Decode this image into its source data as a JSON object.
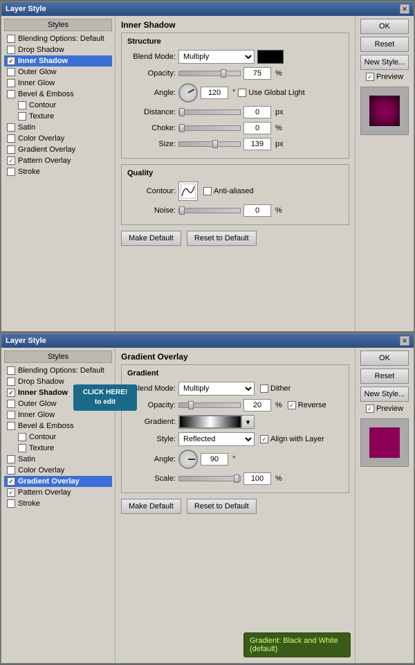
{
  "panel1": {
    "title": "Layer Style",
    "sidebar": {
      "title": "Styles",
      "items": [
        {
          "id": "blending-options",
          "label": "Blending Options: Default",
          "checked": false,
          "active": false,
          "indent": 0,
          "bold": false
        },
        {
          "id": "drop-shadow",
          "label": "Drop Shadow",
          "checked": false,
          "active": false,
          "indent": 0,
          "bold": false
        },
        {
          "id": "inner-shadow",
          "label": "Inner Shadow",
          "checked": true,
          "active": true,
          "indent": 0,
          "bold": true
        },
        {
          "id": "outer-glow",
          "label": "Outer Glow",
          "checked": false,
          "active": false,
          "indent": 0,
          "bold": false
        },
        {
          "id": "inner-glow",
          "label": "Inner Glow",
          "checked": false,
          "active": false,
          "indent": 0,
          "bold": false
        },
        {
          "id": "bevel-emboss",
          "label": "Bevel & Emboss",
          "checked": false,
          "active": false,
          "indent": 0,
          "bold": false
        },
        {
          "id": "contour",
          "label": "Contour",
          "checked": false,
          "active": false,
          "indent": 1,
          "bold": false
        },
        {
          "id": "texture",
          "label": "Texture",
          "checked": false,
          "active": false,
          "indent": 1,
          "bold": false
        },
        {
          "id": "satin",
          "label": "Satin",
          "checked": false,
          "active": false,
          "indent": 0,
          "bold": false
        },
        {
          "id": "color-overlay",
          "label": "Color Overlay",
          "checked": false,
          "active": false,
          "indent": 0,
          "bold": false
        },
        {
          "id": "gradient-overlay",
          "label": "Gradient Overlay",
          "checked": false,
          "active": false,
          "indent": 0,
          "bold": false
        },
        {
          "id": "pattern-overlay",
          "label": "Pattern Overlay",
          "checked": true,
          "active": false,
          "indent": 0,
          "bold": false
        },
        {
          "id": "stroke",
          "label": "Stroke",
          "checked": false,
          "active": false,
          "indent": 0,
          "bold": false
        }
      ]
    },
    "main": {
      "section": "Inner Shadow",
      "structure_title": "Structure",
      "blend_mode_label": "Blend Mode:",
      "blend_mode_value": "Multiply",
      "opacity_label": "Opacity:",
      "opacity_value": "75",
      "opacity_unit": "%",
      "angle_label": "Angle:",
      "angle_value": "120",
      "angle_unit": "°",
      "use_global_light": "Use Global Light",
      "distance_label": "Distance:",
      "distance_value": "0",
      "distance_unit": "px",
      "choke_label": "Choke:",
      "choke_value": "0",
      "choke_unit": "%",
      "size_label": "Size:",
      "size_value": "139",
      "size_unit": "px",
      "quality_title": "Quality",
      "contour_label": "Contour:",
      "anti_aliased": "Anti-aliased",
      "noise_label": "Noise:",
      "noise_value": "0",
      "noise_unit": "%",
      "make_default": "Make Default",
      "reset_to_default": "Reset to Default"
    },
    "buttons": {
      "ok": "OK",
      "reset": "Reset",
      "new_style": "New Style...",
      "preview": "Preview"
    }
  },
  "panel2": {
    "title": "Layer Style",
    "sidebar": {
      "title": "Styles",
      "items": [
        {
          "id": "blending-options2",
          "label": "Blending Options: Default",
          "checked": false,
          "active": false,
          "indent": 0,
          "bold": false
        },
        {
          "id": "drop-shadow2",
          "label": "Drop Shadow",
          "checked": false,
          "active": false,
          "indent": 0,
          "bold": false
        },
        {
          "id": "inner-shadow2",
          "label": "Inner Shadow",
          "checked": true,
          "active": false,
          "indent": 0,
          "bold": true
        },
        {
          "id": "outer-glow2",
          "label": "Outer Glow",
          "checked": false,
          "active": false,
          "indent": 0,
          "bold": false
        },
        {
          "id": "inner-glow2",
          "label": "Inner Glow",
          "checked": false,
          "active": false,
          "indent": 0,
          "bold": false
        },
        {
          "id": "bevel-emboss2",
          "label": "Bevel & Emboss",
          "checked": false,
          "active": false,
          "indent": 0,
          "bold": false
        },
        {
          "id": "contour2",
          "label": "Contour",
          "checked": false,
          "active": false,
          "indent": 1,
          "bold": false
        },
        {
          "id": "texture2",
          "label": "Texture",
          "checked": false,
          "active": false,
          "indent": 1,
          "bold": false
        },
        {
          "id": "satin2",
          "label": "Satin",
          "checked": false,
          "active": false,
          "indent": 0,
          "bold": false
        },
        {
          "id": "color-overlay2",
          "label": "Color Overlay",
          "checked": false,
          "active": false,
          "indent": 0,
          "bold": false
        },
        {
          "id": "gradient-overlay2",
          "label": "Gradient Overlay",
          "checked": true,
          "active": true,
          "indent": 0,
          "bold": true
        },
        {
          "id": "pattern-overlay2",
          "label": "Pattern Overlay",
          "checked": true,
          "active": false,
          "indent": 0,
          "bold": false
        },
        {
          "id": "stroke2",
          "label": "Stroke",
          "checked": false,
          "active": false,
          "indent": 0,
          "bold": false
        }
      ]
    },
    "main": {
      "section": "Gradient Overlay",
      "gradient_title": "Gradient",
      "blend_mode_label": "Blend Mode:",
      "blend_mode_value": "Multiply",
      "dither": "Dither",
      "opacity_label": "Opacity:",
      "opacity_value": "20",
      "opacity_unit": "%",
      "reverse": "Reverse",
      "gradient_label": "Gradient:",
      "style_label": "Style:",
      "style_value": "Reflected",
      "align_with_layer": "Align with Layer",
      "angle_label": "Angle:",
      "angle_value": "90",
      "scale_label": "Scale:",
      "scale_value": "100",
      "scale_unit": "%",
      "make_default": "Make Default",
      "reset_to_default": "Reset to Default"
    },
    "buttons": {
      "ok": "OK",
      "reset": "Reset",
      "new_style": "New Style...",
      "preview": "Preview"
    },
    "tooltip": {
      "text": "Gradient: Black and White (default)"
    },
    "click_tooltip": {
      "text": "CLICK HERE!\nto edit"
    }
  }
}
